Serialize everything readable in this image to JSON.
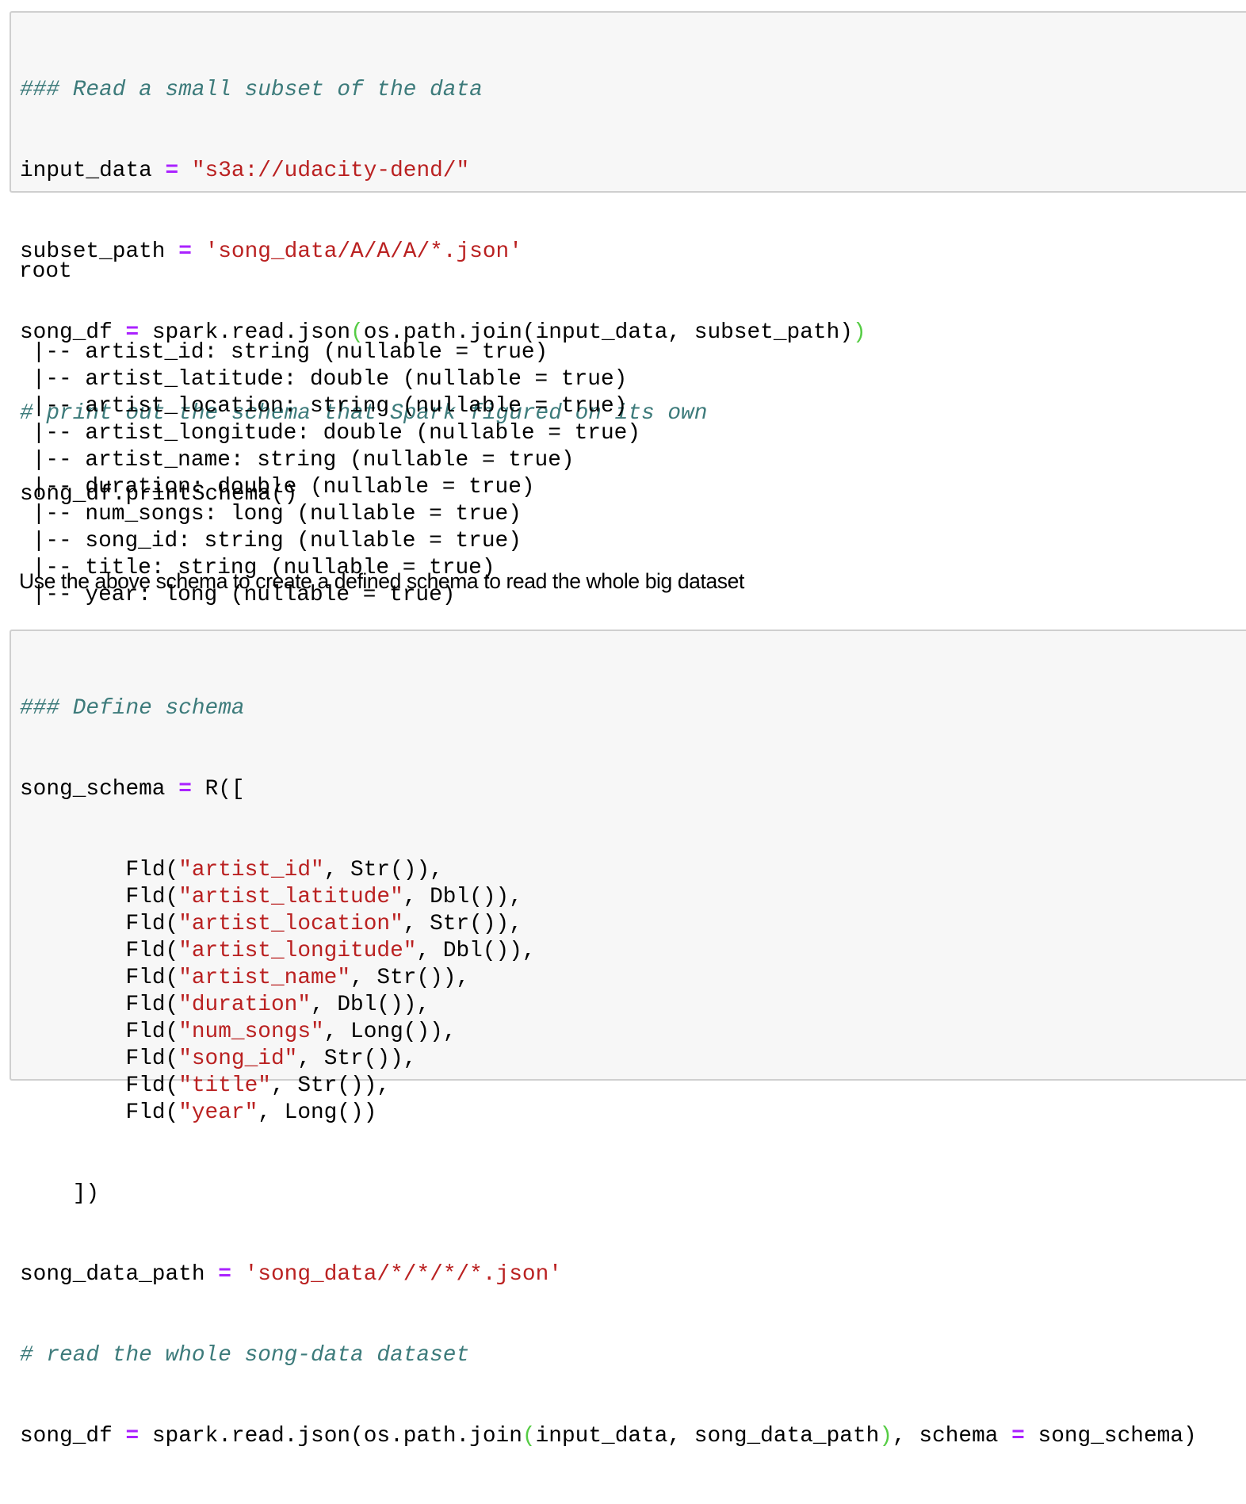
{
  "cell1": {
    "comment_header": "### Read a small subset of the data",
    "line_input_data": {
      "var": "input_data",
      "op": "=",
      "value": "\"s3a://udacity-dend/\""
    },
    "line_subset_path": {
      "var": "subset_path",
      "op": "=",
      "value": "'song_data/A/A/A/*.json'"
    },
    "line_read": {
      "var": "song_df",
      "op": "=",
      "call_start": "spark.read.json",
      "open_paren": "(",
      "inner": "os.path.join(input_data, subset_path)",
      "close_paren": ")"
    },
    "comment_print": "# print out the schema that Spark figured on its own",
    "line_print": "song_df.printSchema()"
  },
  "output": {
    "root": "root",
    "fields": [
      {
        "prefix": " |-- ",
        "text": "artist_id: string (nullable = true)"
      },
      {
        "prefix": " |-- ",
        "text": "artist_latitude: double (nullable = true)"
      },
      {
        "prefix": " |-- ",
        "text": "artist_location: string (nullable = true)"
      },
      {
        "prefix": " |-- ",
        "text": "artist_longitude: double (nullable = true)"
      },
      {
        "prefix": " |-- ",
        "text": "artist_name: string (nullable = true)"
      },
      {
        "prefix": " |-- ",
        "text": "duration: double (nullable = true)"
      },
      {
        "prefix": " |-- ",
        "text": "num_songs: long (nullable = true)"
      },
      {
        "prefix": " |-- ",
        "text": "song_id: string (nullable = true)"
      },
      {
        "prefix": " |-- ",
        "text": "title: string (nullable = true)"
      },
      {
        "prefix": " |-- ",
        "text": "year: long (nullable = true)"
      }
    ]
  },
  "markdown": {
    "text": "Use the above schema to create a defined schema to read the whole big dataset"
  },
  "cell2": {
    "comment_header": "### Define schema",
    "schema_start": {
      "var": "song_schema",
      "op": "=",
      "rest": "R(["
    },
    "fields": [
      {
        "indent": "        ",
        "fn": "Fld(",
        "name": "\"artist_id\"",
        "type": ", Str()),"
      },
      {
        "indent": "        ",
        "fn": "Fld(",
        "name": "\"artist_latitude\"",
        "type": ", Dbl()),"
      },
      {
        "indent": "        ",
        "fn": "Fld(",
        "name": "\"artist_location\"",
        "type": ", Str()),"
      },
      {
        "indent": "        ",
        "fn": "Fld(",
        "name": "\"artist_longitude\"",
        "type": ", Dbl()),"
      },
      {
        "indent": "        ",
        "fn": "Fld(",
        "name": "\"artist_name\"",
        "type": ", Str()),"
      },
      {
        "indent": "        ",
        "fn": "Fld(",
        "name": "\"duration\"",
        "type": ", Dbl()),"
      },
      {
        "indent": "        ",
        "fn": "Fld(",
        "name": "\"num_songs\"",
        "type": ", Long()),"
      },
      {
        "indent": "        ",
        "fn": "Fld(",
        "name": "\"song_id\"",
        "type": ", Str()),"
      },
      {
        "indent": "        ",
        "fn": "Fld(",
        "name": "\"title\"",
        "type": ", Str()),"
      },
      {
        "indent": "        ",
        "fn": "Fld(",
        "name": "\"year\"",
        "type": ", Long())"
      }
    ],
    "schema_end": "    ])",
    "line_path": {
      "var": "song_data_path",
      "op": "=",
      "value": "'song_data/*/*/*/*.json'"
    },
    "comment_read": "# read the whole song-data dataset",
    "line_read": {
      "var": "song_df",
      "op": "=",
      "call_start": "spark.read.json(os.path.join",
      "open_paren": "(",
      "inner": "input_data, song_data_path",
      "close_paren": ")",
      "tail1": ", schema ",
      "op2": "=",
      "tail2": " song_schema)"
    }
  }
}
